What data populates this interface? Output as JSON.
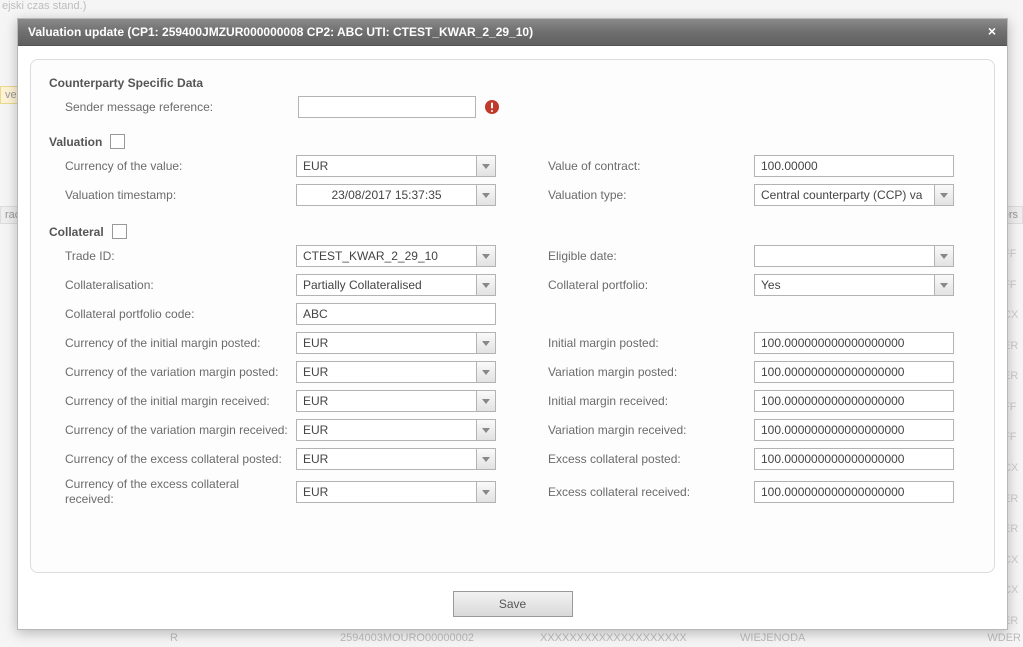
{
  "background": {
    "topLeft": "ejski czas stand.)",
    "leftTab1": "ve",
    "leftTab2": "rac",
    "rightTab": "xers",
    "rightCol": [
      "FF",
      "FF",
      "CX",
      "ER",
      "ER",
      "FF",
      "FF",
      "CX",
      "ER",
      "ER",
      "CX",
      "CX",
      "ER"
    ],
    "bottomRow": [
      "R",
      "2594003MOURO00000002",
      "XXXXXXXXXXXXXXXXXXXX",
      "WIEJENODA",
      "WDER"
    ]
  },
  "modal": {
    "title": "Valuation update (CP1: 259400JMZUR000000008 CP2: ABC UTI: CTEST_KWAR_2_29_10)"
  },
  "sections": {
    "cpData": "Counterparty Specific Data",
    "valuation": "Valuation",
    "collateral": "Collateral"
  },
  "labels": {
    "senderMsgRef": "Sender message reference:",
    "currencyOfValue": "Currency of the value:",
    "valueOfContract": "Value of contract:",
    "valuationTimestamp": "Valuation timestamp:",
    "valuationType": "Valuation type:",
    "tradeId": "Trade ID:",
    "eligibleDate": "Eligible date:",
    "collateralisation": "Collateralisation:",
    "collateralPortfolio": "Collateral portfolio:",
    "collateralPortfolioCode": "Collateral portfolio code:",
    "curInitMarginPosted": "Currency of the initial margin posted:",
    "initMarginPosted": "Initial margin posted:",
    "curVarMarginPosted": "Currency of the variation margin posted:",
    "varMarginPosted": "Variation margin posted:",
    "curInitMarginRecv": "Currency of the initial margin received:",
    "initMarginRecv": "Initial margin received:",
    "curVarMarginRecv": "Currency of the variation margin received:",
    "varMarginRecv": "Variation margin received:",
    "curExcessCollPosted": "Currency of the excess collateral posted:",
    "excessCollPosted": "Excess collateral posted:",
    "curExcessCollRecv": "Currency of the excess collateral received:",
    "excessCollRecv": "Excess collateral received:"
  },
  "values": {
    "senderMsgRef": "",
    "currencyOfValue": "EUR",
    "valueOfContract": "100.00000",
    "valuationTimestamp": "23/08/2017 15:37:35",
    "valuationType": "Central counterparty (CCP) va",
    "tradeId": "CTEST_KWAR_2_29_10",
    "eligibleDate": "",
    "collateralisation": "Partially Collateralised",
    "collateralPortfolio": "Yes",
    "collateralPortfolioCode": "ABC",
    "curInitMarginPosted": "EUR",
    "initMarginPosted": "100.000000000000000000",
    "curVarMarginPosted": "EUR",
    "varMarginPosted": "100.000000000000000000",
    "curInitMarginRecv": "EUR",
    "initMarginRecv": "100.000000000000000000",
    "curVarMarginRecv": "EUR",
    "varMarginRecv": "100.000000000000000000",
    "curExcessCollPosted": "EUR",
    "excessCollPosted": "100.000000000000000000",
    "curExcessCollRecv": "EUR",
    "excessCollRecv": "100.000000000000000000"
  },
  "buttons": {
    "save": "Save",
    "close": "×"
  }
}
